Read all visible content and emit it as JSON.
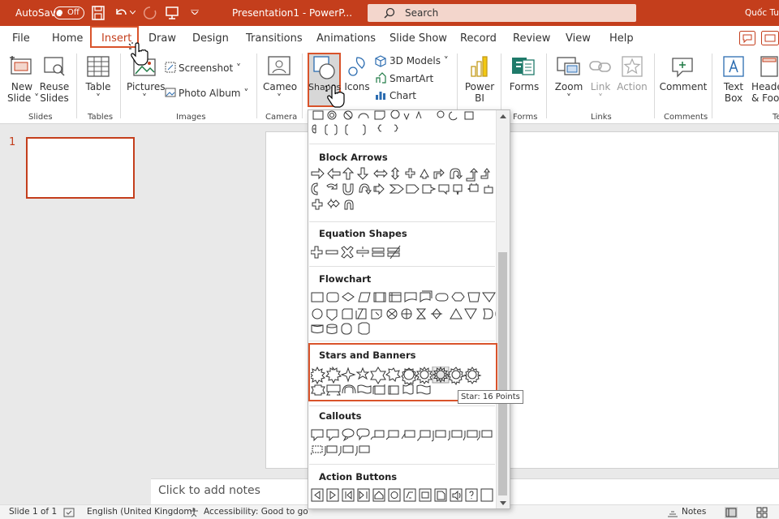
{
  "titlebar": {
    "autosave_label": "AutoSave",
    "autosave_state": "Off",
    "doc_title": "Presentation1  -  PowerP...",
    "search_placeholder": "Search",
    "user": "Quốc Tuấ"
  },
  "tabs": [
    "File",
    "Home",
    "Insert",
    "Draw",
    "Design",
    "Transitions",
    "Animations",
    "Slide Show",
    "Record",
    "Review",
    "View",
    "Help"
  ],
  "ribbon": {
    "new_slide": [
      "New",
      "Slide ˅"
    ],
    "reuse_slides": [
      "Reuse",
      "Slides"
    ],
    "table": [
      "Table",
      "˅"
    ],
    "pictures": [
      "Pictures",
      "˅"
    ],
    "screenshot": "Screenshot ˅",
    "photo_album": "Photo Album  ˅",
    "cameo": [
      "Cameo",
      "˅"
    ],
    "shapes": "Shapes",
    "icons": "Icons",
    "models_3d": "3D Models  ˅",
    "smartart": "SmartArt",
    "chart": "Chart",
    "power_bi": [
      "Power",
      "BI"
    ],
    "forms": "Forms",
    "zoom": [
      "Zoom",
      "˅"
    ],
    "link": [
      "Link",
      "˅"
    ],
    "action": "Action",
    "comment": "Comment",
    "text_box": [
      "Text",
      "Box"
    ],
    "header_footer": [
      "Heade",
      "& Foot"
    ],
    "groups": {
      "slides": "Slides",
      "tables": "Tables",
      "images": "Images",
      "camera": "Camera",
      "forms": "Forms",
      "links": "Links",
      "comments": "Comments",
      "text": "Te"
    }
  },
  "slides_panel": {
    "slide_number": "1"
  },
  "notes_placeholder": "Click to add notes",
  "status": {
    "slide_of": "Slide 1 of 1",
    "language": "English (United Kingdom)",
    "accessibility": "Accessibility: Good to go",
    "notes": "Notes"
  },
  "dropdown": {
    "sections": [
      "Block Arrows",
      "Equation Shapes",
      "Flowchart",
      "Stars and Banners",
      "Callouts",
      "Action Buttons"
    ],
    "tooltip": "Star: 16 Points"
  },
  "colors": {
    "accent": "#c43e1c",
    "highlight": "#d9532b"
  }
}
